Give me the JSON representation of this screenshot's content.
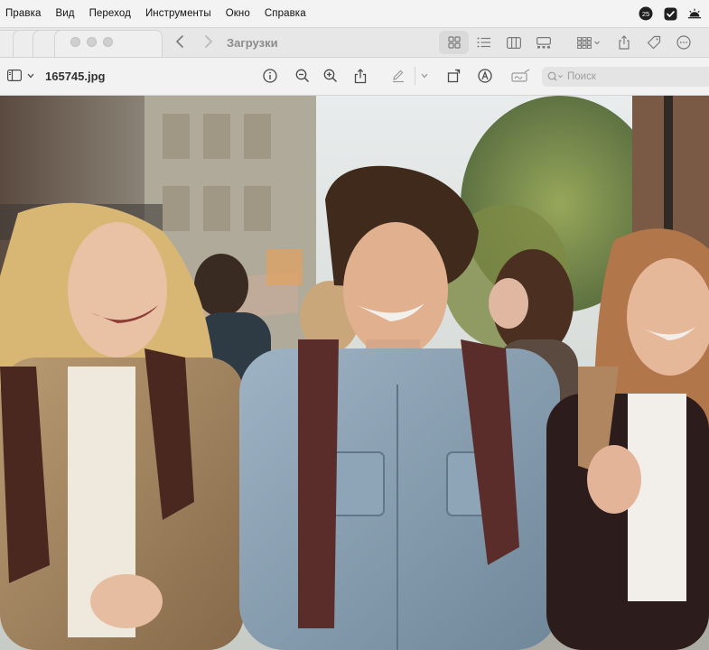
{
  "menubar": {
    "items": [
      "Правка",
      "Вид",
      "Переход",
      "Инструменты",
      "Окно",
      "Справка"
    ],
    "status_icons": [
      "calendar-badge-icon",
      "shield-check-icon",
      "brightness-icon"
    ],
    "badge": "25"
  },
  "finder": {
    "title": "Загрузки",
    "nav_icons": [
      "back-chevron-icon",
      "forward-chevron-icon"
    ],
    "view_icons": [
      "icon-view-icon",
      "list-view-icon",
      "column-view-icon",
      "gallery-view-icon",
      "group-icon",
      "share-icon",
      "tag-icon",
      "more-icon"
    ]
  },
  "preview": {
    "filename": "165745.jpg",
    "search_placeholder": "Поиск",
    "tool_icons": [
      "info-icon",
      "zoom-out-icon",
      "zoom-in-icon",
      "share-icon",
      "markup-pen-icon",
      "markup-menu-icon",
      "rotate-icon",
      "annotate-icon",
      "signature-icon"
    ]
  },
  "colors": {
    "menubar_bg": "#f3f3f3",
    "toolbar_bg": "#f2f2f2",
    "icon": "#4a4a4a"
  }
}
